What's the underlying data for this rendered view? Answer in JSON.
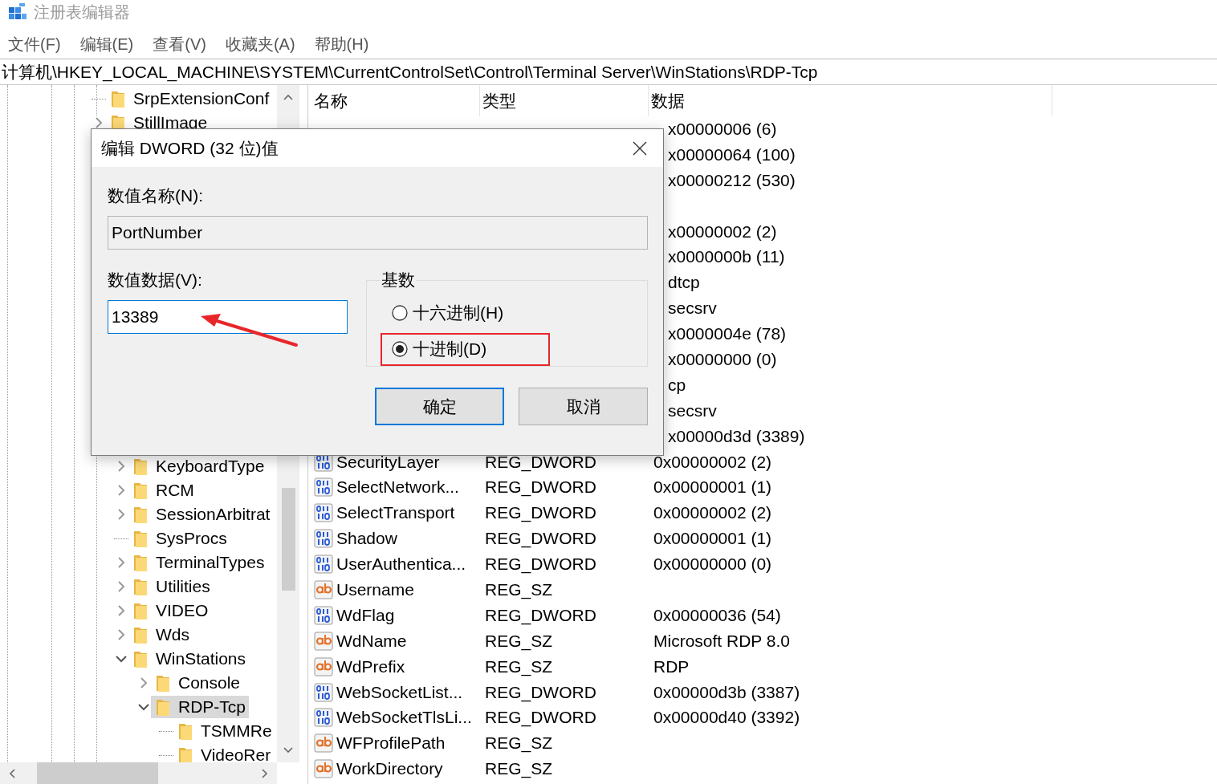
{
  "window": {
    "title": "注册表编辑器"
  },
  "menu": [
    "文件(F)",
    "编辑(E)",
    "查看(V)",
    "收藏夹(A)",
    "帮助(H)"
  ],
  "address": "计算机\\HKEY_LOCAL_MACHINE\\SYSTEM\\CurrentControlSet\\Control\\Terminal Server\\WinStations\\RDP-Tcp",
  "tree": [
    {
      "label": "SrpExtensionConf",
      "has_children": false,
      "selected": false
    },
    {
      "label": "StillImage",
      "has_children": true,
      "expanded": false,
      "selected": false
    },
    {
      "children": [
        {
          "label": "KeyboardType",
          "has_children": true,
          "expanded": false,
          "selected": false
        },
        {
          "label": "RCM",
          "has_children": true,
          "expanded": false,
          "selected": false
        },
        {
          "label": "SessionArbitrat",
          "has_children": true,
          "expanded": false,
          "selected": false
        },
        {
          "label": "SysProcs",
          "has_children": false,
          "selected": false
        },
        {
          "label": "TerminalTypes",
          "has_children": true,
          "expanded": false,
          "selected": false
        },
        {
          "label": "Utilities",
          "has_children": true,
          "expanded": false,
          "selected": false
        },
        {
          "label": "VIDEO",
          "has_children": true,
          "expanded": false,
          "selected": false
        },
        {
          "label": "Wds",
          "has_children": true,
          "expanded": false,
          "selected": false
        },
        {
          "label": "WinStations",
          "has_children": true,
          "expanded": true,
          "selected": false,
          "children": [
            {
              "label": "Console",
              "has_children": true,
              "expanded": false,
              "selected": false
            },
            {
              "label": "RDP-Tcp",
              "has_children": true,
              "expanded": true,
              "selected": true,
              "children": [
                {
                  "label": "TSMMRe",
                  "has_children": false,
                  "selected": false
                },
                {
                  "label": "VideoRer",
                  "has_children": false,
                  "selected": false
                }
              ]
            }
          ]
        }
      ]
    }
  ],
  "list": {
    "columns": [
      "名称",
      "类型",
      "数据"
    ],
    "covered_data": [
      {
        "kind": "text",
        "data": "x00000006 (6)"
      },
      {
        "kind": "text",
        "data": "x00000064 (100)"
      },
      {
        "kind": "text",
        "data": "x00000212 (530)"
      },
      {
        "kind": "blank"
      },
      {
        "kind": "text",
        "data": "x00000002 (2)"
      },
      {
        "kind": "text",
        "data": "x0000000b (11)"
      },
      {
        "kind": "text",
        "data": "dtcp"
      },
      {
        "kind": "text",
        "data": "secsrv"
      },
      {
        "kind": "text",
        "data": "x0000004e (78)"
      },
      {
        "kind": "text",
        "data": "x00000000 (0)"
      },
      {
        "kind": "text",
        "data": "cp"
      },
      {
        "kind": "text",
        "data": "secsrv"
      },
      {
        "kind": "text",
        "data": "x00000d3d (3389)"
      }
    ],
    "rows": [
      {
        "kind": "dword",
        "name": "SecurityLayer",
        "type": "REG_DWORD",
        "data": "0x00000002 (2)"
      },
      {
        "kind": "dword",
        "name": "SelectNetwork...",
        "type": "REG_DWORD",
        "data": "0x00000001 (1)"
      },
      {
        "kind": "dword",
        "name": "SelectTransport",
        "type": "REG_DWORD",
        "data": "0x00000002 (2)"
      },
      {
        "kind": "dword",
        "name": "Shadow",
        "type": "REG_DWORD",
        "data": "0x00000001 (1)"
      },
      {
        "kind": "dword",
        "name": "UserAuthentica...",
        "type": "REG_DWORD",
        "data": "0x00000000 (0)"
      },
      {
        "kind": "sz",
        "name": "Username",
        "type": "REG_SZ"
      },
      {
        "kind": "dword",
        "name": "WdFlag",
        "type": "REG_DWORD",
        "data": "0x00000036 (54)"
      },
      {
        "kind": "sz",
        "name": "WdName",
        "type": "REG_SZ",
        "data": "Microsoft RDP 8.0"
      },
      {
        "kind": "sz",
        "name": "WdPrefix",
        "type": "REG_SZ",
        "data": "RDP"
      },
      {
        "kind": "dword",
        "name": "WebSocketList...",
        "type": "REG_DWORD",
        "data": "0x00000d3b (3387)"
      },
      {
        "kind": "dword",
        "name": "WebSocketTlsLi...",
        "type": "REG_DWORD",
        "data": "0x00000d40 (3392)"
      },
      {
        "kind": "sz",
        "name": "WFProfilePath",
        "type": "REG_SZ"
      },
      {
        "kind": "sz",
        "name": "WorkDirectory",
        "type": "REG_SZ"
      }
    ]
  },
  "dialog": {
    "title": "编辑 DWORD (32 位)值",
    "name_label": "数值名称(N):",
    "name_value": "PortNumber",
    "data_label": "数值数据(V):",
    "data_value": "13389",
    "data_annotated": true,
    "base": {
      "title": "基数",
      "options": [
        {
          "label": "十六进制(H)",
          "selected": false,
          "highlighted": false
        },
        {
          "label": "十进制(D)",
          "selected": true,
          "highlighted": true
        }
      ]
    },
    "buttons": [
      {
        "label": "确定",
        "default": true
      },
      {
        "label": "取消",
        "default": false
      }
    ]
  }
}
